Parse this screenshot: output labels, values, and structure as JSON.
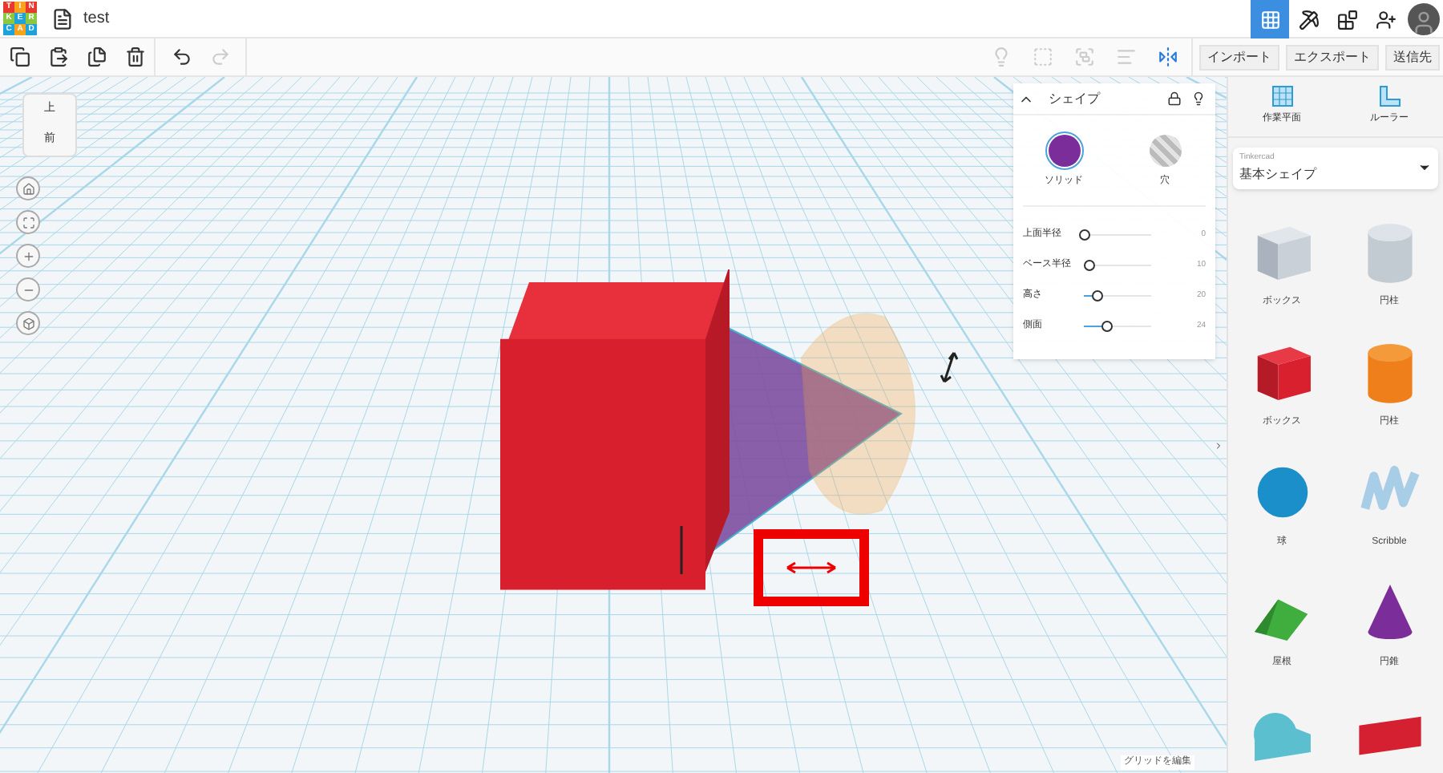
{
  "logo": {
    "letters": [
      {
        "char": "T",
        "color": "#e8392f"
      },
      {
        "char": "I",
        "color": "#f8a31b"
      },
      {
        "char": "N",
        "color": "#e8392f"
      },
      {
        "char": "K",
        "color": "#8dc63f"
      },
      {
        "char": "E",
        "color": "#1ea2dc"
      },
      {
        "char": "R",
        "color": "#8dc63f"
      },
      {
        "char": "C",
        "color": "#1ea2dc"
      },
      {
        "char": "A",
        "color": "#f8a31b"
      },
      {
        "char": "D",
        "color": "#1ea2dc"
      }
    ]
  },
  "window": {
    "title": "test"
  },
  "top_nav": [
    {
      "kind": "grid",
      "selected": true
    },
    {
      "kind": "pickaxe",
      "selected": false
    },
    {
      "kind": "bricks",
      "selected": false
    },
    {
      "kind": "user-add",
      "selected": false
    },
    {
      "kind": "avatar",
      "selected": false
    }
  ],
  "toolbar": {
    "edit_tools": [
      {
        "kind": "copy",
        "disabled": false
      },
      {
        "kind": "paste",
        "disabled": false
      },
      {
        "kind": "duplicate",
        "disabled": false
      },
      {
        "kind": "delete",
        "disabled": false
      },
      {
        "kind": "undo",
        "disabled": false
      },
      {
        "kind": "redo",
        "disabled": true
      }
    ],
    "view_tools": [
      {
        "kind": "light",
        "disabled": true
      },
      {
        "kind": "group",
        "disabled": true
      },
      {
        "kind": "ungroup",
        "disabled": true
      },
      {
        "kind": "align",
        "disabled": true
      },
      {
        "kind": "mirror",
        "disabled": false
      }
    ],
    "buttons": [
      "インポート",
      "エクスポート",
      "送信先"
    ]
  },
  "view_cube": {
    "top": "上",
    "front": "前"
  },
  "inspector": {
    "title": "シェイプ",
    "modes": [
      {
        "label": "ソリッド",
        "kind": "solid",
        "selected": true
      },
      {
        "label": "穴",
        "kind": "hole",
        "selected": false
      }
    ],
    "sliders": [
      {
        "label": "上面半径",
        "level": 0.0,
        "reading": "0"
      },
      {
        "label": "ベース半径",
        "level": 0.06,
        "reading": "10"
      },
      {
        "label": "高さ",
        "level": 0.2,
        "reading": "20"
      },
      {
        "label": "側面",
        "level": 0.33,
        "reading": "24"
      }
    ]
  },
  "sidebar": {
    "tools": [
      {
        "kind": "workplane",
        "label": "作業平面"
      },
      {
        "kind": "ruler",
        "label": "ルーラー"
      }
    ],
    "library": {
      "source": "Tinkercad",
      "name": "基本シェイプ"
    },
    "shapes": [
      {
        "kind": "box-hole",
        "label": "ボックス"
      },
      {
        "kind": "cylinder-hole",
        "label": "円柱"
      },
      {
        "kind": "box",
        "label": "ボックス"
      },
      {
        "kind": "cylinder",
        "label": "円柱"
      },
      {
        "kind": "sphere",
        "label": "球"
      },
      {
        "kind": "scribble",
        "label": "Scribble"
      },
      {
        "kind": "roof",
        "label": "屋根"
      },
      {
        "kind": "cone",
        "label": "円錐"
      },
      {
        "kind": "half-cylinder"
      },
      {
        "kind": "text-3d"
      }
    ]
  },
  "footer": {
    "edit_grid": "グリッドを編集"
  }
}
